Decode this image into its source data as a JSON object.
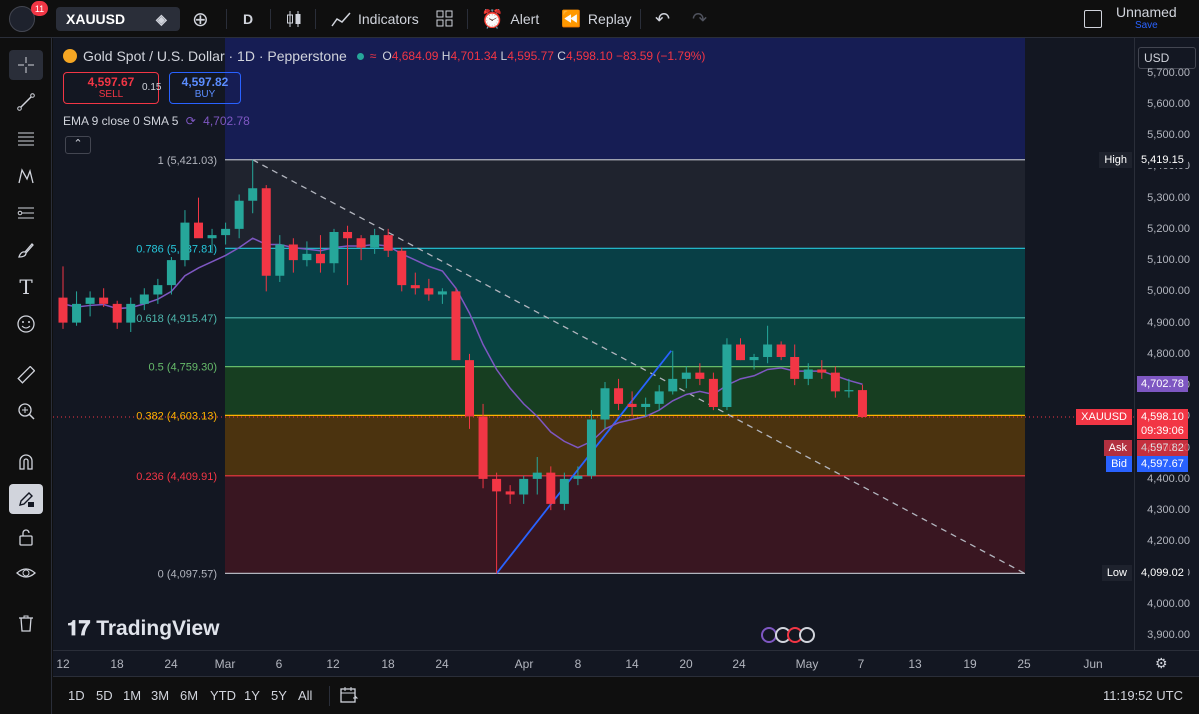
{
  "topbar": {
    "notification_count": "11",
    "symbol": "XAUUSD",
    "interval": "D",
    "indicators_label": "Indicators",
    "alert_label": "Alert",
    "replay_label": "Replay",
    "layout_name": "Unnamed",
    "save_label": "Save"
  },
  "legend": {
    "title": "Gold Spot / U.S. Dollar · 1D · Pepperstone",
    "open_k": "O",
    "open_v": "4,684.09",
    "high_k": "H",
    "high_v": "4,701.34",
    "low_k": "L",
    "low_v": "4,595.77",
    "close_k": "C",
    "close_v": "4,598.10",
    "change": "−83.59 (−1.79%)",
    "sell_price": "4,597.67",
    "sell_label": "SELL",
    "spread": "0.15",
    "buy_price": "4,597.82",
    "buy_label": "BUY",
    "ema_label": "EMA 9 close 0 SMA 5",
    "ema_value": "4,702.78"
  },
  "watermark": "TradingView",
  "currency": "USD",
  "chart_data": {
    "type": "candlestick",
    "symbol": "XAUUSD",
    "interval": "1D",
    "ylim": [
      3850,
      5760
    ],
    "y_ticks": [
      3900,
      4000,
      4100,
      4200,
      4300,
      4400,
      4500,
      4600,
      4700,
      4800,
      4900,
      5000,
      5100,
      5200,
      5300,
      5400,
      5500,
      5600,
      5700
    ],
    "x_ticks": [
      "12",
      "18",
      "24",
      "Mar",
      "6",
      "12",
      "18",
      "24",
      "Apr",
      "8",
      "14",
      "20",
      "24",
      "May",
      "7",
      "13",
      "19",
      "25",
      "Jun"
    ],
    "candles": [
      [
        4980,
        5080,
        4880,
        4900
      ],
      [
        4900,
        5000,
        4890,
        4960
      ],
      [
        4960,
        5000,
        4920,
        4980
      ],
      [
        4980,
        5010,
        4950,
        4960
      ],
      [
        4960,
        4970,
        4880,
        4900
      ],
      [
        4900,
        4980,
        4870,
        4960
      ],
      [
        4960,
        5010,
        4940,
        4990
      ],
      [
        4990,
        5040,
        4960,
        5020
      ],
      [
        5020,
        5110,
        4990,
        5100
      ],
      [
        5100,
        5260,
        5080,
        5220
      ],
      [
        5220,
        5300,
        5180,
        5170
      ],
      [
        5170,
        5200,
        5130,
        5180
      ],
      [
        5180,
        5220,
        5150,
        5200
      ],
      [
        5200,
        5310,
        5170,
        5290
      ],
      [
        5290,
        5421,
        5250,
        5330
      ],
      [
        5330,
        5340,
        5000,
        5050
      ],
      [
        5050,
        5180,
        5030,
        5150
      ],
      [
        5150,
        5170,
        5060,
        5100
      ],
      [
        5100,
        5160,
        5080,
        5120
      ],
      [
        5120,
        5180,
        5060,
        5090
      ],
      [
        5090,
        5200,
        5060,
        5190
      ],
      [
        5190,
        5210,
        5020,
        5170
      ],
      [
        5170,
        5180,
        5100,
        5140
      ],
      [
        5140,
        5200,
        5120,
        5180
      ],
      [
        5180,
        5200,
        5110,
        5130
      ],
      [
        5130,
        5140,
        5000,
        5020
      ],
      [
        5020,
        5060,
        4990,
        5010
      ],
      [
        5010,
        5040,
        4970,
        4990
      ],
      [
        4990,
        5010,
        4960,
        5000
      ],
      [
        5000,
        5010,
        4780,
        4780
      ],
      [
        4780,
        4800,
        4560,
        4600
      ],
      [
        4600,
        4640,
        4370,
        4400
      ],
      [
        4400,
        4420,
        4097.57,
        4360
      ],
      [
        4360,
        4380,
        4320,
        4350
      ],
      [
        4350,
        4410,
        4320,
        4400
      ],
      [
        4400,
        4470,
        4350,
        4420
      ],
      [
        4420,
        4440,
        4300,
        4320
      ],
      [
        4320,
        4420,
        4300,
        4400
      ],
      [
        4400,
        4440,
        4380,
        4410
      ],
      [
        4410,
        4620,
        4400,
        4590
      ],
      [
        4590,
        4710,
        4560,
        4690
      ],
      [
        4690,
        4720,
        4620,
        4640
      ],
      [
        4640,
        4680,
        4600,
        4630
      ],
      [
        4630,
        4660,
        4600,
        4640
      ],
      [
        4640,
        4700,
        4620,
        4680
      ],
      [
        4680,
        4810,
        4670,
        4720
      ],
      [
        4720,
        4760,
        4690,
        4740
      ],
      [
        4740,
        4770,
        4700,
        4720
      ],
      [
        4720,
        4740,
        4620,
        4630
      ],
      [
        4630,
        4850,
        4620,
        4830
      ],
      [
        4830,
        4850,
        4780,
        4780
      ],
      [
        4780,
        4800,
        4750,
        4790
      ],
      [
        4790,
        4890,
        4770,
        4830
      ],
      [
        4830,
        4840,
        4780,
        4790
      ],
      [
        4790,
        4830,
        4700,
        4720
      ],
      [
        4720,
        4770,
        4700,
        4750
      ],
      [
        4750,
        4780,
        4720,
        4740
      ],
      [
        4740,
        4760,
        4660,
        4680
      ],
      [
        4680,
        4720,
        4660,
        4684.09
      ],
      [
        4684.09,
        4701.34,
        4595.77,
        4598.1
      ]
    ],
    "ema_line": [
      4960,
      4950,
      4955,
      4958,
      4945,
      4948,
      4960,
      4975,
      5000,
      5050,
      5075,
      5095,
      5115,
      5140,
      5170,
      5150,
      5150,
      5140,
      5135,
      5130,
      5140,
      5145,
      5145,
      5150,
      5145,
      5120,
      5100,
      5080,
      5065,
      5010,
      4930,
      4830,
      4750,
      4690,
      4640,
      4600,
      4550,
      4520,
      4500,
      4520,
      4560,
      4580,
      4590,
      4600,
      4620,
      4650,
      4670,
      4680,
      4670,
      4700,
      4720,
      4730,
      4750,
      4755,
      4745,
      4745,
      4745,
      4730,
      4715,
      4702.78
    ],
    "fibonacci": [
      {
        "level": "1",
        "price": 5421.03,
        "label": "1 (5,421.03)",
        "color": "#b2b5be"
      },
      {
        "level": "0.786",
        "price": 5137.81,
        "label": "0.786 (5,137.81)",
        "color": "#26c6da"
      },
      {
        "level": "0.618",
        "price": 4915.47,
        "label": "0.618 (4,915.47)",
        "color": "#4db6ac"
      },
      {
        "level": "0.5",
        "price": 4759.3,
        "label": "0.5 (4,759.30)",
        "color": "#66bb6a"
      },
      {
        "level": "0.382",
        "price": 4603.13,
        "label": "0.382 (4,603.13)",
        "color": "#ffb300"
      },
      {
        "level": "0.236",
        "price": 4409.91,
        "label": "0.236 (4,409.91)",
        "color": "#f23645"
      },
      {
        "level": "0",
        "price": 4097.57,
        "label": "0 (4,097.57)",
        "color": "#b2b5be"
      }
    ],
    "high_label": "High",
    "high_value": "5,419.15",
    "low_label": "Low",
    "low_value": "4,099.02",
    "ema_tag": "4,702.78",
    "last_symbol": "XAUUSD",
    "last_price": "4,598.10",
    "countdown": "09:39:06",
    "ask_label": "Ask",
    "ask_price": "4,597.82",
    "bid_label": "Bid",
    "bid_price": "4,597.67",
    "colors": {
      "up": "#26a69a",
      "down": "#f23645",
      "ema": "#7e57c2"
    }
  },
  "bottom": {
    "ranges": [
      "1D",
      "5D",
      "1M",
      "3M",
      "6M",
      "YTD",
      "1Y",
      "5Y",
      "All"
    ],
    "clock": "11:19:52 UTC"
  }
}
